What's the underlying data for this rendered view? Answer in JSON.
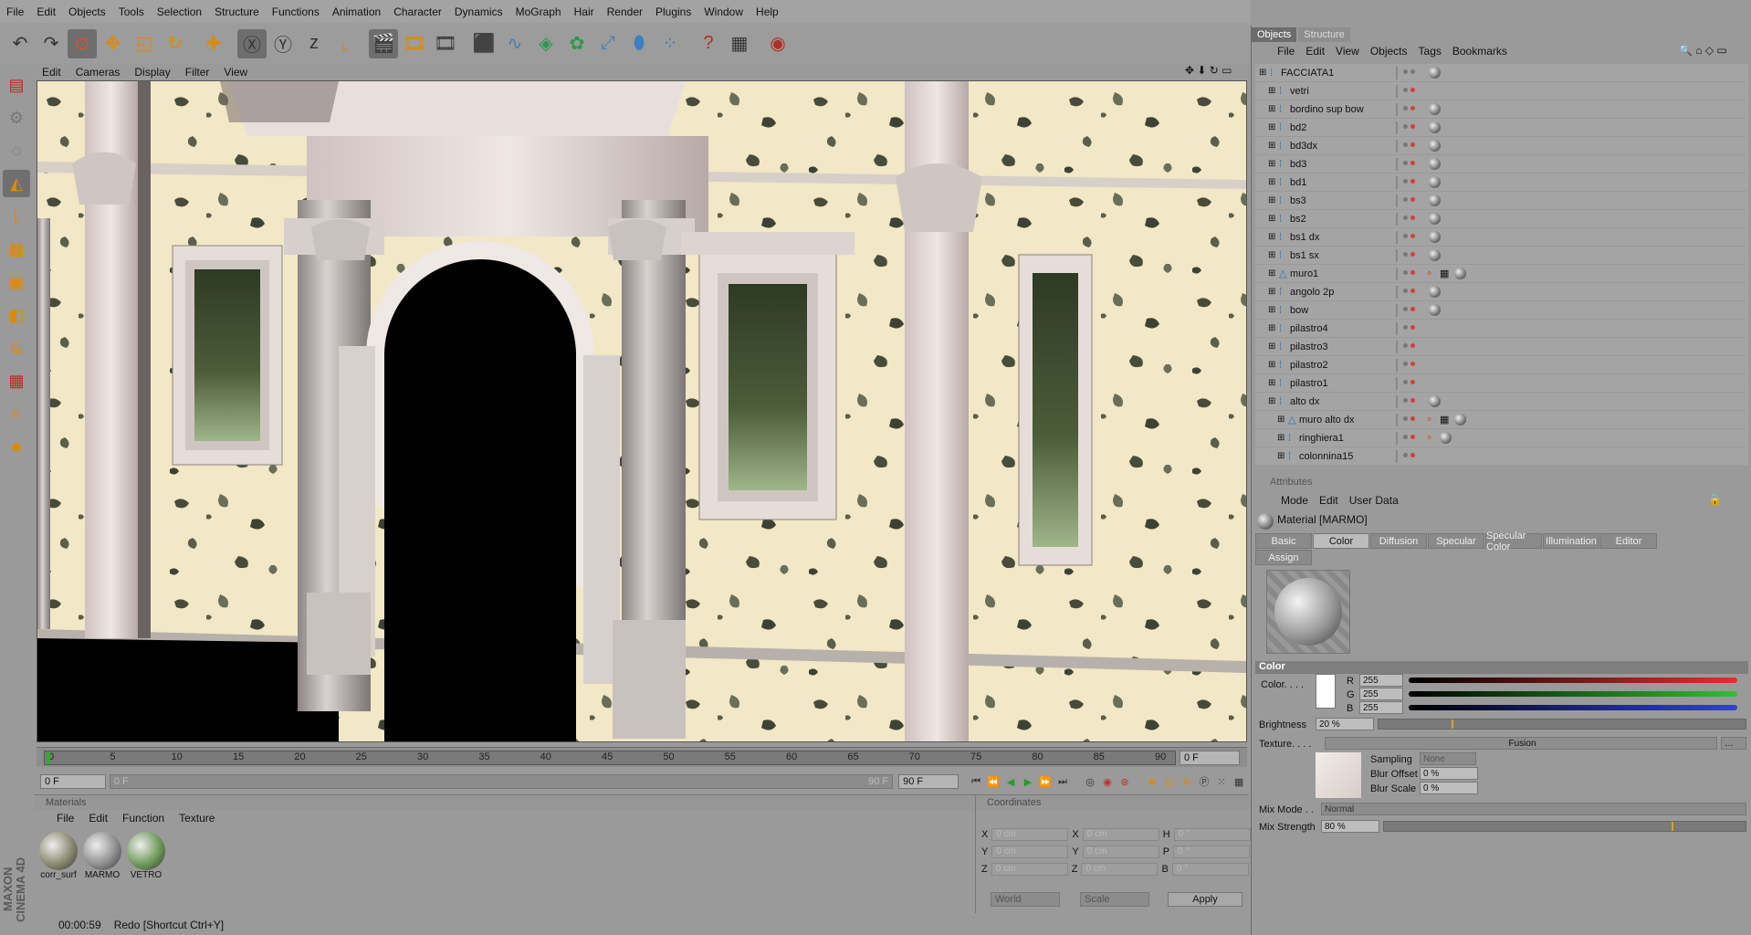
{
  "menubar": [
    "File",
    "Edit",
    "Objects",
    "Tools",
    "Selection",
    "Structure",
    "Functions",
    "Animation",
    "Character",
    "Dynamics",
    "MoGraph",
    "Hair",
    "Render",
    "Plugins",
    "Window",
    "Help"
  ],
  "viewport_menu": [
    "Edit",
    "Cameras",
    "Display",
    "Filter",
    "View"
  ],
  "timeline": {
    "ticks": [
      "0",
      "5",
      "10",
      "15",
      "20",
      "25",
      "30",
      "35",
      "40",
      "45",
      "50",
      "55",
      "60",
      "65",
      "70",
      "75",
      "80",
      "85",
      "90"
    ],
    "current_frame": "0 F",
    "start_frame": "0 F",
    "range_start": "0 F",
    "range_end": "90 F",
    "end_frame": "90 F"
  },
  "materials_panel": {
    "title": "Materials",
    "menu": [
      "File",
      "Edit",
      "Function",
      "Texture"
    ],
    "items": [
      {
        "name": "corr_surf",
        "color": "#8a8a70"
      },
      {
        "name": "MARMO",
        "color": "#8f8f8f"
      },
      {
        "name": "VETRO",
        "color": "#6f9a5a"
      }
    ]
  },
  "coordinates_panel": {
    "title": "Coordinates",
    "rows": [
      {
        "a": "X",
        "av": "0 cm",
        "b": "X",
        "bv": "0 cm",
        "c": "H",
        "cv": "0 °"
      },
      {
        "a": "Y",
        "av": "0 cm",
        "b": "Y",
        "bv": "0 cm",
        "c": "P",
        "cv": "0 °"
      },
      {
        "a": "Z",
        "av": "0 cm",
        "b": "Z",
        "bv": "0 cm",
        "c": "B",
        "cv": "0 °"
      }
    ],
    "mode": "World",
    "scale": "Scale",
    "apply": "Apply"
  },
  "status": {
    "time": "00:00:59",
    "message": "Redo [Shortcut Ctrl+Y]"
  },
  "maxon_logo": "MAXON CINEMA 4D",
  "objects_panel": {
    "tabs": [
      "Objects",
      "Structure"
    ],
    "menu": [
      "File",
      "Edit",
      "View",
      "Objects",
      "Tags",
      "Bookmarks"
    ],
    "rows": [
      {
        "name": "FACCIATA1",
        "indent": 0,
        "tag": "ball"
      },
      {
        "name": "vetri",
        "indent": 1,
        "tag": ""
      },
      {
        "name": "bordino sup bow",
        "indent": 1,
        "tag": "ball"
      },
      {
        "name": "bd2",
        "indent": 1,
        "tag": "ball"
      },
      {
        "name": "bd3dx",
        "indent": 1,
        "tag": "ball"
      },
      {
        "name": "bd3",
        "indent": 1,
        "tag": "ball"
      },
      {
        "name": "bd1",
        "indent": 1,
        "tag": "ball"
      },
      {
        "name": "bs3",
        "indent": 1,
        "tag": "ball"
      },
      {
        "name": "bs2",
        "indent": 1,
        "tag": "ball"
      },
      {
        "name": "bs1 dx",
        "indent": 1,
        "tag": "ball"
      },
      {
        "name": "bs1 sx",
        "indent": 1,
        "tag": "ball"
      },
      {
        "name": "muro1",
        "indent": 1,
        "tag": "multi"
      },
      {
        "name": "angolo 2p",
        "indent": 1,
        "tag": "ball"
      },
      {
        "name": "bow",
        "indent": 1,
        "tag": "ball"
      },
      {
        "name": "pilastro4",
        "indent": 1,
        "tag": ""
      },
      {
        "name": "pilastro3",
        "indent": 1,
        "tag": ""
      },
      {
        "name": "pilastro2",
        "indent": 1,
        "tag": ""
      },
      {
        "name": "pilastro1",
        "indent": 1,
        "tag": ""
      },
      {
        "name": "alto dx",
        "indent": 1,
        "tag": "ball"
      },
      {
        "name": "muro alto dx",
        "indent": 2,
        "tag": "multi"
      },
      {
        "name": "ringhiera1",
        "indent": 2,
        "tag": "ball2"
      },
      {
        "name": "colonnina15",
        "indent": 2,
        "tag": ""
      }
    ]
  },
  "attributes_panel": {
    "title": "Attributes",
    "menu": [
      "Mode",
      "Edit",
      "User Data"
    ],
    "material_title": "Material [MARMO]",
    "tabs": [
      "Basic",
      "Color",
      "Diffusion",
      "Specular",
      "Specular Color",
      "Illumination",
      "Editor",
      "Assign"
    ],
    "active_tab": "Color",
    "section": "Color",
    "color_label": "Color. . . .",
    "r": "255",
    "g": "255",
    "b": "255",
    "brightness_label": "Brightness",
    "brightness": "20 %",
    "brightness_level": 0.2,
    "texture_label": "Texture. . . .",
    "texture_value": "Fusion",
    "sampling_label": "Sampling",
    "sampling": "None",
    "blur_offset_label": "Blur Offset",
    "blur_offset": "0 %",
    "blur_scale_label": "Blur Scale",
    "blur_scale": "0 %",
    "mix_mode_label": "Mix Mode . .",
    "mix_mode": "Normal",
    "mix_strength_label": "Mix Strength",
    "mix_strength": "80 %",
    "mix_strength_level": 0.8
  }
}
